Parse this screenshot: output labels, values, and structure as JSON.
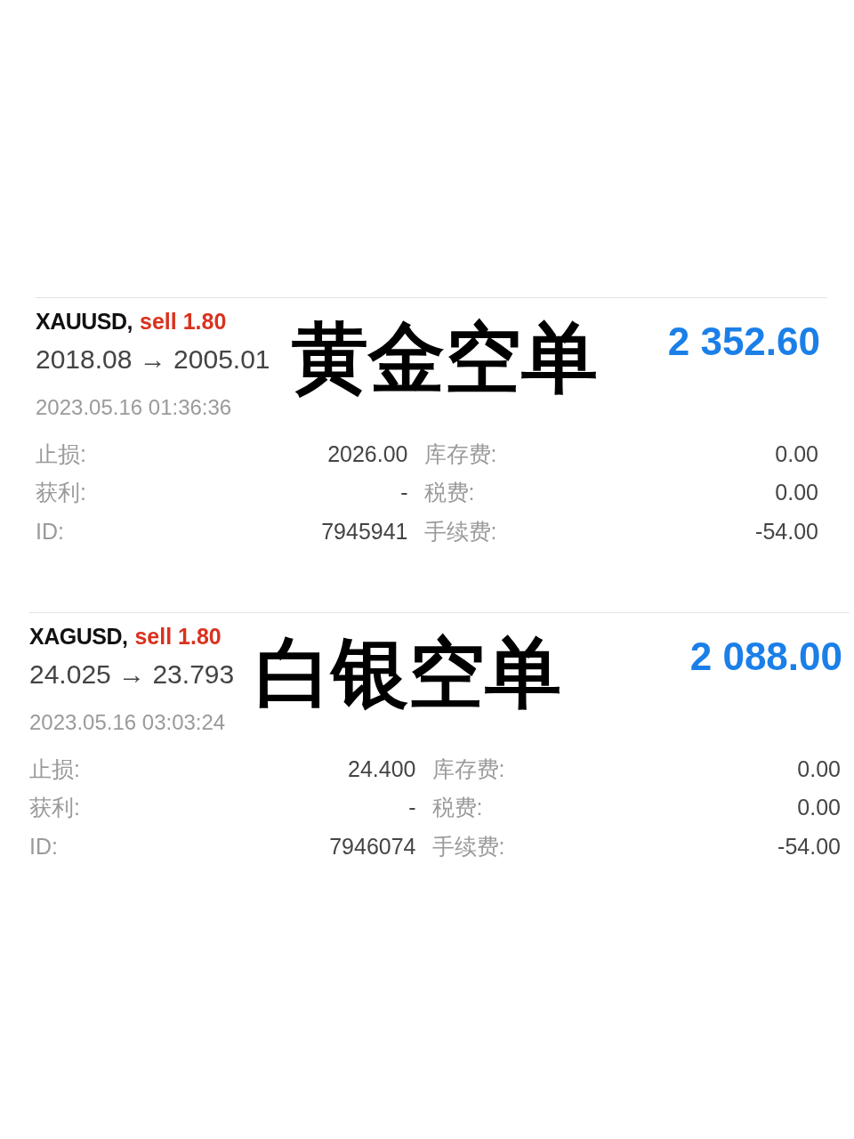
{
  "trades": [
    {
      "symbol": "XAUUSD,",
      "side": "sell 1.80",
      "prices": "2018.08 → 2005.01",
      "annotation": "黄金空单",
      "profit": "2 352.60",
      "time": "2023.05.16 01:36:36",
      "rows": [
        [
          "止损:",
          "2026.00",
          "库存费:",
          "0.00"
        ],
        [
          "获利:",
          "-",
          "税费:",
          "0.00"
        ],
        [
          "ID:",
          "7945941",
          "手续费:",
          "-54.00"
        ]
      ]
    },
    {
      "symbol": "XAGUSD,",
      "side": "sell 1.80",
      "prices": "24.025 → 23.793",
      "annotation": "白银空单",
      "profit": "2 088.00",
      "time": "2023.05.16 03:03:24",
      "rows": [
        [
          "止损:",
          "24.400",
          "库存费:",
          "0.00"
        ],
        [
          "获利:",
          "-",
          "税费:",
          "0.00"
        ],
        [
          "ID:",
          "7946074",
          "手续费:",
          "-54.00"
        ]
      ]
    }
  ]
}
